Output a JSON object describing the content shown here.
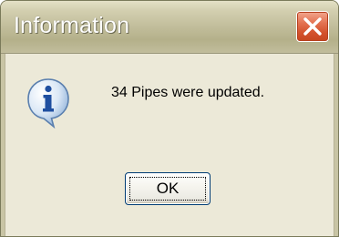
{
  "window": {
    "title": "Information",
    "close_icon": "close-icon",
    "info_icon": "information-icon"
  },
  "dialog": {
    "message": "34 Pipes were updated.",
    "ok_label": "OK"
  },
  "colors": {
    "face": "#ece9d8",
    "title_text": "#ffffff",
    "close_button": "#d4532e",
    "button_border": "#003c74"
  }
}
